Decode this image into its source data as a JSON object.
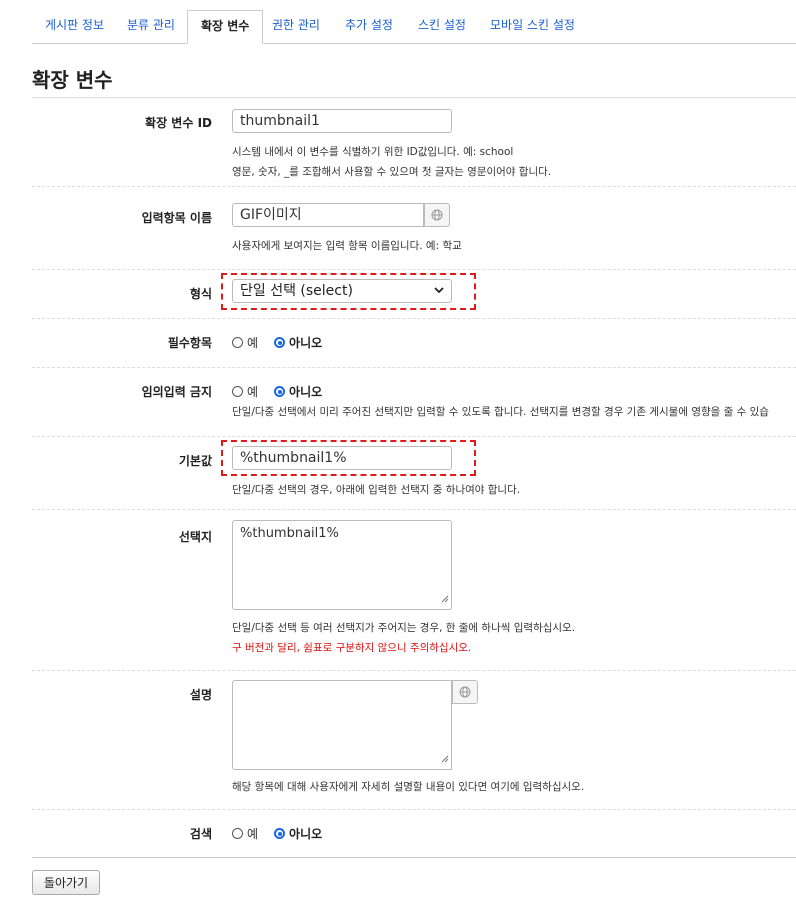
{
  "tabs": [
    {
      "label": "게시판 정보"
    },
    {
      "label": "분류 관리"
    },
    {
      "label": "확장 변수"
    },
    {
      "label": "권한 관리"
    },
    {
      "label": "추가 설정"
    },
    {
      "label": "스킨 설정"
    },
    {
      "label": "모바일 스킨 설정"
    }
  ],
  "active_tab": "확장 변수",
  "page_title": "확장 변수",
  "form": {
    "var_id": {
      "label": "확장 변수 ID",
      "value": "thumbnail1",
      "help": [
        "시스템 내에서 이 변수를 식별하기 위한 ID값입니다. 예: school",
        "영문, 숫자, _를 조합해서 사용할 수 있으며 첫 글자는 영문이어야 합니다."
      ]
    },
    "input_name": {
      "label": "입력항목 이름",
      "value": "GIF이미지",
      "help": "사용자에게 보여지는 입력 항목 이름입니다. 예: 학교"
    },
    "type": {
      "label": "형식",
      "value": "단일 선택 (select)"
    },
    "required": {
      "label": "필수항목",
      "options": [
        "예",
        "아니오"
      ],
      "selected": "아니오"
    },
    "no_free_input": {
      "label": "임의입력 금지",
      "options": [
        "예",
        "아니오"
      ],
      "selected": "아니오",
      "help": "단일/다중 선택에서 미리 주어진 선택지만 입력할 수 있도록 합니다. 선택지를 변경할 경우 기존 게시물에 영향을 줄 수 있습"
    },
    "default": {
      "label": "기본값",
      "value": "%thumbnail1%",
      "help": "단일/다중 선택의 경우, 아래에 입력한 선택지 중 하나여야 합니다."
    },
    "options": {
      "label": "선택지",
      "value": "%thumbnail1%",
      "help": "단일/다중 선택 등 여러 선택지가 주어지는 경우, 한 줄에 하나씩 입력하십시오.",
      "warning": "구 버전과 달리, 쉼표로 구분하지 않으니 주의하십시오."
    },
    "description": {
      "label": "설명",
      "value": "",
      "help": "해당 항목에 대해 사용자에게 자세히 설명할 내용이 있다면 여기에 입력하십시오."
    },
    "search": {
      "label": "검색",
      "options": [
        "예",
        "아니오"
      ],
      "selected": "아니오"
    }
  },
  "back_button": "돌아가기",
  "colors": {
    "link": "#1a5fd4",
    "highlight": "#e01a1a",
    "warning": "#e01010",
    "radio_on": "#1a66e0"
  },
  "icons": {
    "globe": "globe-icon",
    "chevron": "chevron-down-icon"
  }
}
